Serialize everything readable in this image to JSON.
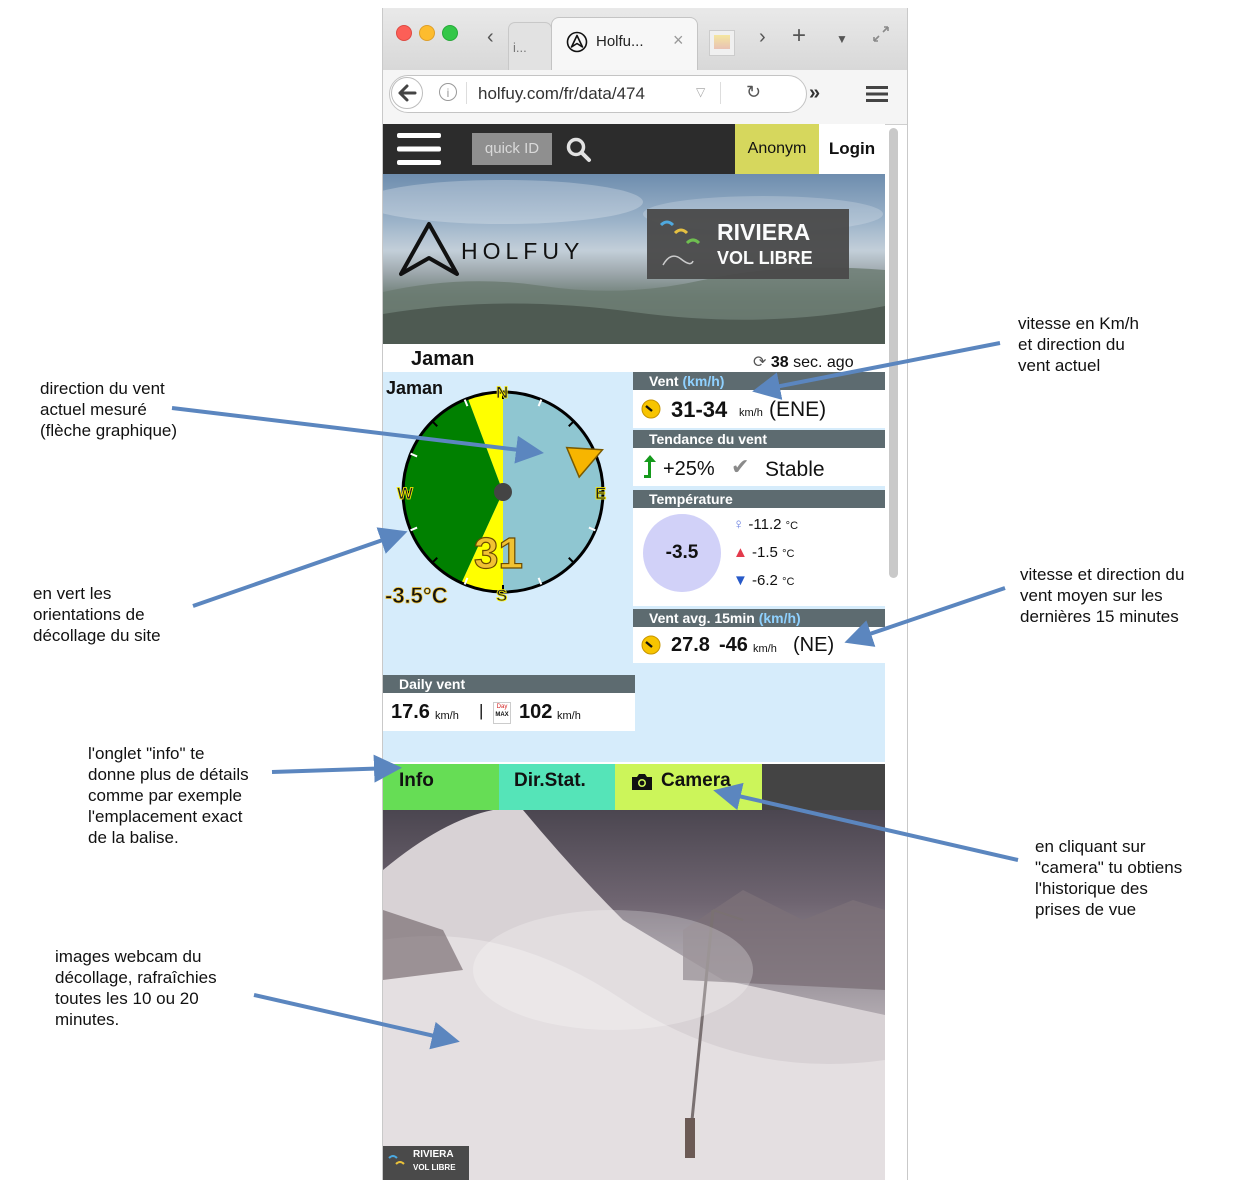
{
  "browser": {
    "tabs": [
      {
        "label": "i..."
      },
      {
        "label": "Holfu...",
        "close": "×",
        "active": true
      }
    ],
    "url": "holfuy.com/fr/data/474"
  },
  "site": {
    "quick_id_placeholder": "quick ID",
    "anonym_label": "Anonym",
    "login_label": "Login",
    "banner": {
      "logo_text": "HOLFUY",
      "sponsor_line1": "RIVIERA",
      "sponsor_line2": "VOL LIBRE"
    }
  },
  "station": {
    "name": "Jaman",
    "updated_value": "38",
    "updated_suffix": "sec. ago"
  },
  "compass": {
    "station_label": "Jaman",
    "north": "N",
    "east": "E",
    "south": "S",
    "west": "W",
    "speed": "31",
    "temperature": "-3.5°C",
    "wind_arrow_deg": 67
  },
  "wind": {
    "header": "Vent",
    "header_unit": "(km/h)",
    "speed_range": "31-34",
    "unit": "km/h",
    "direction": "(ENE)"
  },
  "trend": {
    "header": "Tendance du vent",
    "change": "+25%",
    "status": "Stable"
  },
  "temperature": {
    "header": "Température",
    "current": "-3.5",
    "feels": "-11.2",
    "max": "-1.5",
    "min": "-6.2",
    "unit": "°C"
  },
  "wind_avg": {
    "header": "Vent avg. 15min",
    "header_unit": "(km/h)",
    "avg": "27.8",
    "max": "-46",
    "unit": "km/h",
    "direction": "(NE)"
  },
  "daily_wind": {
    "header": "Daily vent",
    "avg": "17.6",
    "unit": "km/h",
    "separator": "|",
    "max_icon_top": "Day",
    "max_icon_bottom": "MAX",
    "max": "102",
    "max_unit": "km/h"
  },
  "page_tabs": [
    {
      "label": "Info"
    },
    {
      "label": "Dir.Stat."
    },
    {
      "label": "Camera"
    }
  ],
  "webcam": {
    "logo_line1": "RIVIERA",
    "logo_line2": "VOL LIBRE"
  },
  "annotations": {
    "direction": "direction du vent\nactuel mesuré\n(flèche graphique)",
    "green": "en vert les\norientations de\ndécollage du site",
    "info_tab": "l'onglet \"info\" te\ndonne plus de détails\ncomme par exemple\nl'emplacement exact\nde la balise.",
    "webcam": "images webcam du\ndécollage, rafraîchies\ntoutes les 10 ou 20\nminutes.",
    "speed": "vitesse en Km/h\net direction du\nvent actuel",
    "avg": "vitesse et direction du\nvent moyen sur les\ndernières 15 minutes",
    "camera": "en cliquant sur\n\"camera\" tu obtiens\nl'historique des\nprises de vue"
  },
  "colors": {
    "takeoff_sector": "#008000",
    "side_sector": "#ffff00",
    "other_sector": "#8fc6d1",
    "wind_arrow": "#f7b500",
    "annotation_arrow": "#5b86bf",
    "tab_info": "#66dd55",
    "tab_dirstat": "#55e4b8",
    "tab_camera": "#ccf55a"
  }
}
